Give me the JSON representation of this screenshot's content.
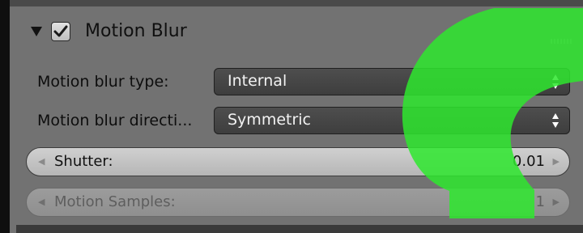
{
  "panel": {
    "title": "Motion Blur",
    "enabled": true
  },
  "fields": {
    "blur_type": {
      "label": "Motion blur type:",
      "value": "Internal"
    },
    "blur_direction": {
      "label": "Motion blur directi...",
      "value": "Symmetric"
    },
    "shutter": {
      "label": "Shutter:",
      "value": "0.01"
    },
    "motion_samples": {
      "label": "Motion Samples:",
      "value": "1",
      "disabled": true
    }
  },
  "colors": {
    "panel_bg": "#727272",
    "dropdown_bg": "#474747",
    "slider_bg": "#c4c4c4",
    "overlay_green": "#2ee82e"
  },
  "icons": {
    "collapse": "triangle-down-icon",
    "checkbox": "checkmark-icon",
    "dropdown": "up-down-arrows-icon",
    "slider_left": "left-arrow-icon",
    "slider_right": "right-arrow-icon"
  }
}
